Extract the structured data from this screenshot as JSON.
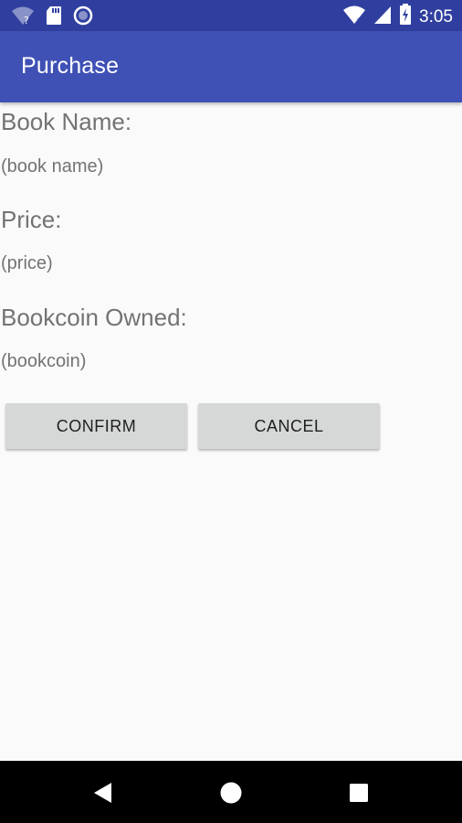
{
  "status_bar": {
    "time": "3:05",
    "icons": [
      "wifi-question-icon",
      "sd-card-icon",
      "circle-notification-icon",
      "wifi-icon",
      "cell-signal-icon",
      "battery-charging-icon"
    ]
  },
  "app_bar": {
    "title": "Purchase",
    "color": "#3F51B5",
    "status_color": "#303F9F"
  },
  "form": {
    "book_name_label": "Book Name:",
    "book_name_value": "(book name)",
    "price_label": "Price:",
    "price_value": "(price)",
    "bookcoin_label": "Bookcoin Owned:",
    "bookcoin_value": "(bookcoin)"
  },
  "buttons": {
    "confirm": "CONFIRM",
    "cancel": "CANCEL"
  },
  "nav_bar": {
    "icons": [
      "back-icon",
      "home-icon",
      "recents-icon"
    ]
  }
}
